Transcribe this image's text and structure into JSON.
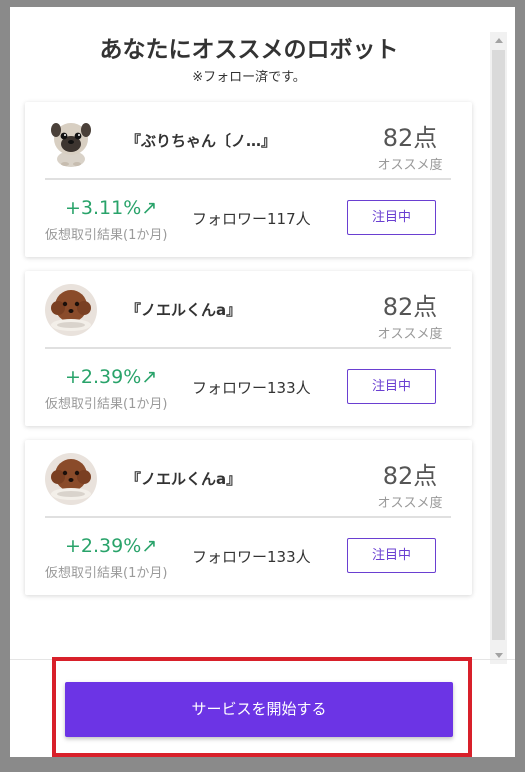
{
  "header": {
    "title": "あなたにオススメのロボット",
    "subtitle": "※フォロー済です。"
  },
  "robots": [
    {
      "name": "『ぶりちゃん〔ノ…』",
      "avatar_icon": "pug-avatar",
      "score": "82点",
      "score_label": "オススメ度",
      "performance": "+3.11%↗",
      "performance_label": "仮想取引結果(1か月)",
      "followers": "フォロワー117人",
      "button_label": "注目中"
    },
    {
      "name": "『ノエルくんa』",
      "avatar_icon": "poodle-avatar",
      "score": "82点",
      "score_label": "オススメ度",
      "performance": "+2.39%↗",
      "performance_label": "仮想取引結果(1か月)",
      "followers": "フォロワー133人",
      "button_label": "注目中"
    },
    {
      "name": "『ノエルくんa』",
      "avatar_icon": "poodle-avatar",
      "score": "82点",
      "score_label": "オススメ度",
      "performance": "+2.39%↗",
      "performance_label": "仮想取引結果(1か月)",
      "followers": "フォロワー133人",
      "button_label": "注目中"
    }
  ],
  "footer": {
    "start_button": "サービスを開始する"
  },
  "colors": {
    "accent": "#6c34e5",
    "positive": "#29a36a",
    "highlight": "#d8202a"
  }
}
